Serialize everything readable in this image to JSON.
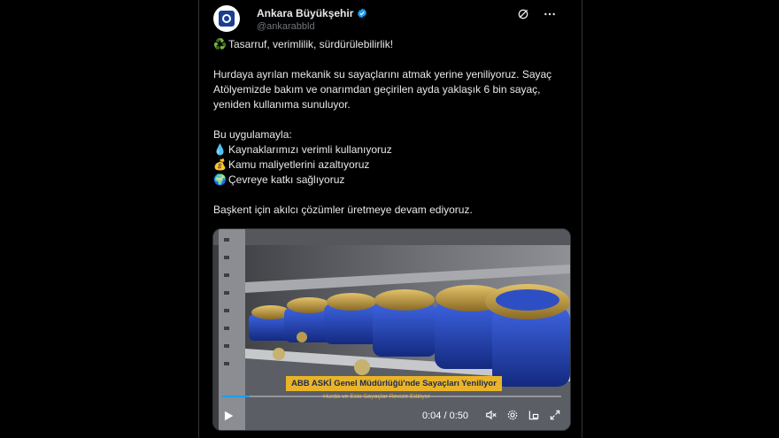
{
  "author": {
    "display_name": "Ankara Büyükşehir",
    "handle": "@ankarabbld"
  },
  "tweet": {
    "line1": "Tasarruf, verimlilik, sürdürülebilirlik!",
    "para1": "Hurdaya ayrılan mekanik su sayaçlarını atmak yerine yeniliyoruz. Sayaç Atölyemizde bakım ve onarımdan geçirilen ayda yaklaşık 6 bin sayaç, yeniden kullanıma sunuluyor.",
    "intro": "Bu uygulamayla:",
    "bullets": [
      {
        "icon": "💧",
        "text": "Kaynaklarımızı verimli kullanıyoruz"
      },
      {
        "icon": "💰",
        "text": "Kamu maliyetlerini azaltıyoruz"
      },
      {
        "icon": "🌍",
        "text": "Çevreye katkı sağlıyoruz"
      }
    ],
    "closing": "Başkent için akılcı çözümler üretmeye devam ediyoruz.",
    "recycle_icon": "♻️"
  },
  "video": {
    "caption_main": "ABB ASKİ Genel Müdürlüğü'nde Sayaçları Yeniliyor",
    "caption_sub": "Hurda ve Eski Sayaçlar Revize Ediliyor",
    "time": "0:04 / 0:50",
    "progress_fraction": 0.08
  },
  "colors": {
    "accent": "#1d9bf0",
    "caption_bg": "#e9b429",
    "meter_blue": "#1f3fb8",
    "meter_brass": "#c9a54a"
  }
}
